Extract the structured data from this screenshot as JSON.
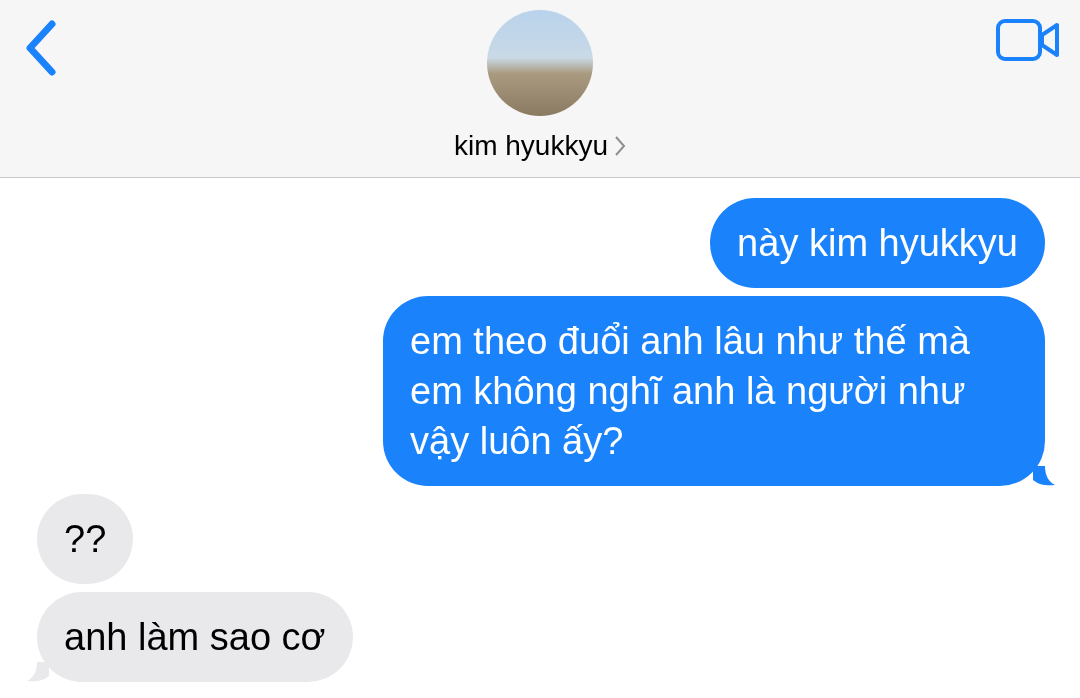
{
  "header": {
    "contact_name": "kim hyukkyu"
  },
  "messages": [
    {
      "kind": "sent",
      "text": "này kim hyukkyu",
      "tail": false
    },
    {
      "kind": "sent",
      "text": "em theo đuổi anh lâu như thế mà em không nghĩ anh là người như vậy luôn ấy?",
      "tail": true
    },
    {
      "kind": "received",
      "text": "??",
      "tail": false
    },
    {
      "kind": "received",
      "text": "anh làm sao cơ",
      "tail": true
    }
  ]
}
